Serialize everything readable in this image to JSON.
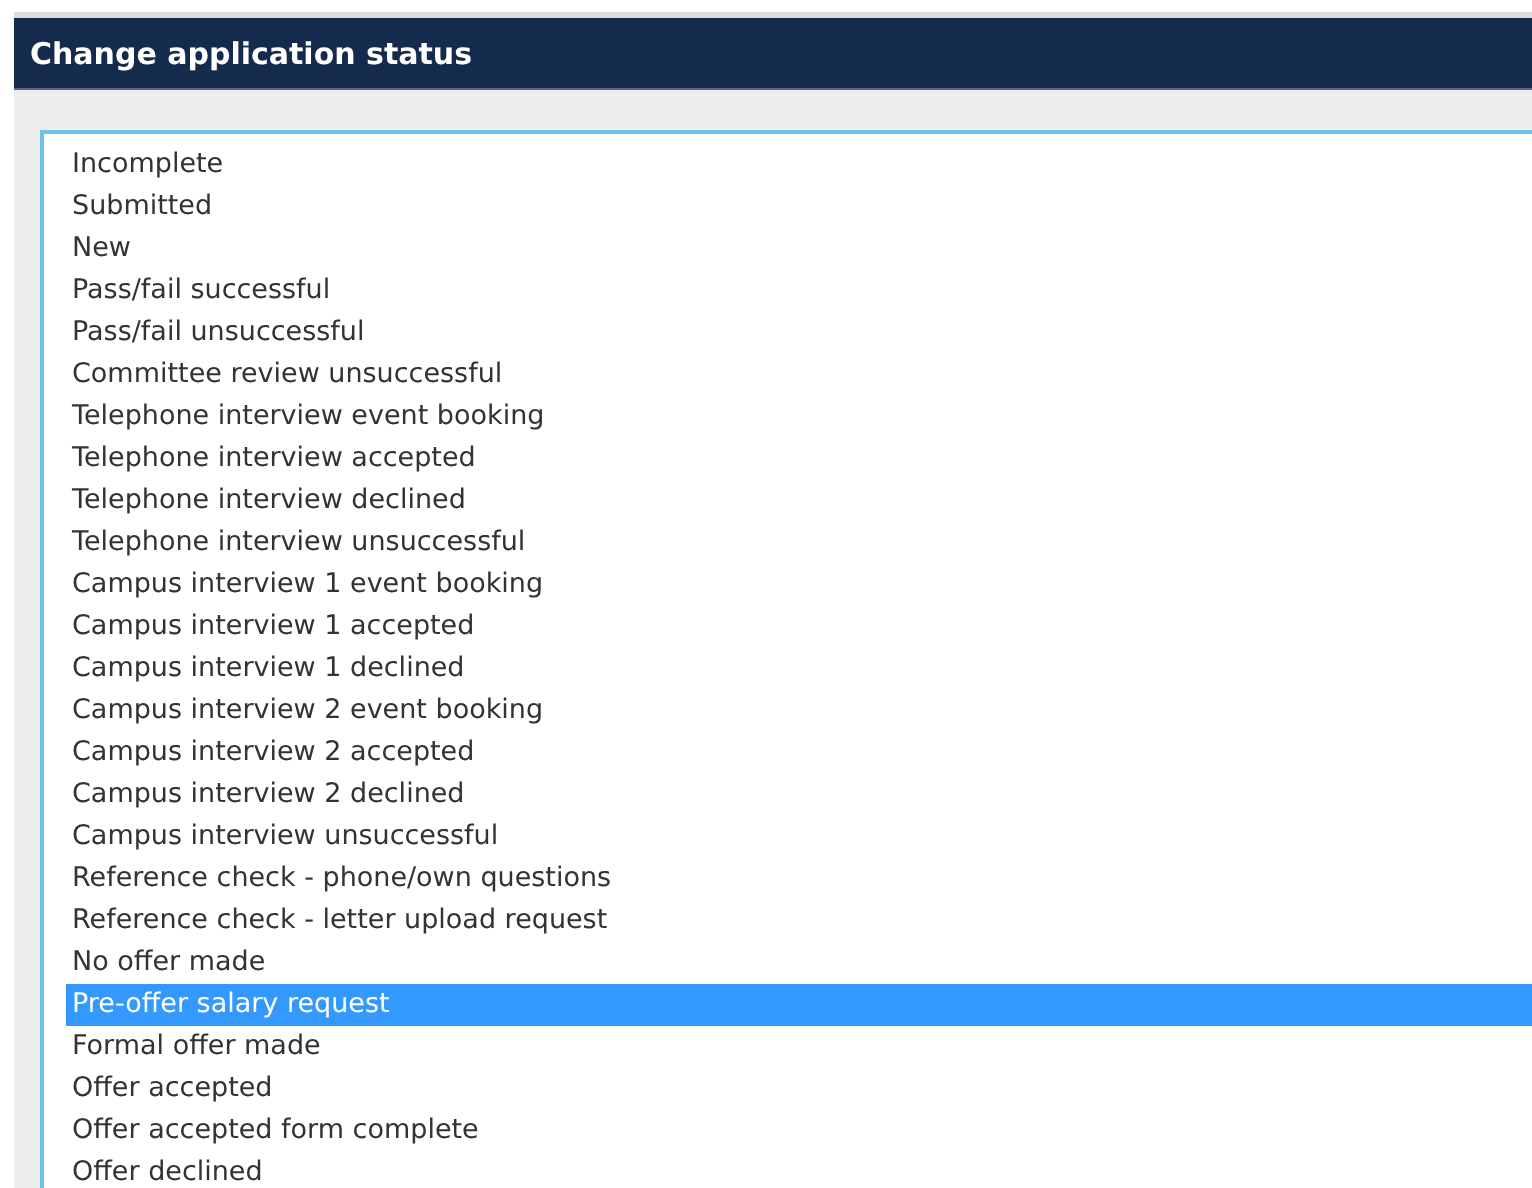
{
  "dialog": {
    "title": "Change application status"
  },
  "status_list": {
    "options": [
      {
        "label": "Incomplete",
        "selected": false
      },
      {
        "label": "Submitted",
        "selected": false
      },
      {
        "label": "New",
        "selected": false
      },
      {
        "label": "Pass/fail successful",
        "selected": false
      },
      {
        "label": "Pass/fail unsuccessful",
        "selected": false
      },
      {
        "label": "Committee review unsuccessful",
        "selected": false
      },
      {
        "label": "Telephone interview event booking",
        "selected": false
      },
      {
        "label": "Telephone interview accepted",
        "selected": false
      },
      {
        "label": "Telephone interview declined",
        "selected": false
      },
      {
        "label": "Telephone interview unsuccessful",
        "selected": false
      },
      {
        "label": "Campus interview 1 event booking",
        "selected": false
      },
      {
        "label": "Campus interview 1 accepted",
        "selected": false
      },
      {
        "label": "Campus interview 1 declined",
        "selected": false
      },
      {
        "label": "Campus interview 2 event booking",
        "selected": false
      },
      {
        "label": "Campus interview 2 accepted",
        "selected": false
      },
      {
        "label": "Campus interview 2 declined",
        "selected": false
      },
      {
        "label": "Campus interview unsuccessful",
        "selected": false
      },
      {
        "label": "Reference check - phone/own questions",
        "selected": false
      },
      {
        "label": "Reference check - letter upload request",
        "selected": false
      },
      {
        "label": "No offer made",
        "selected": false
      },
      {
        "label": "Pre-offer salary request",
        "selected": true
      },
      {
        "label": "Formal offer made",
        "selected": false
      },
      {
        "label": "Offer accepted",
        "selected": false
      },
      {
        "label": "Offer accepted form complete",
        "selected": false
      },
      {
        "label": "Offer declined",
        "selected": false
      }
    ]
  }
}
